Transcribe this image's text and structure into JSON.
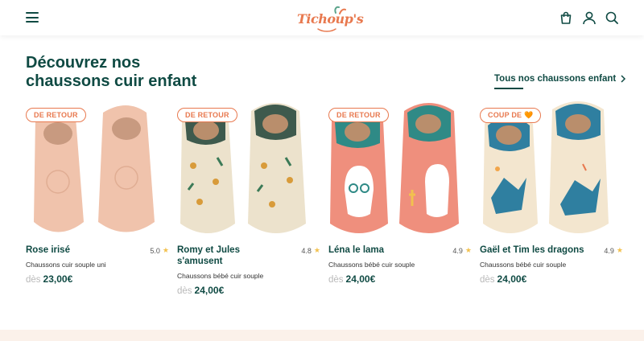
{
  "header": {
    "logo_text": "Tichoup's",
    "icons": [
      "menu-icon",
      "bag-icon",
      "user-icon",
      "search-icon"
    ]
  },
  "section": {
    "title_line1": "Découvrez nos",
    "title_line2": "chaussons cuir enfant",
    "see_all": "Tous nos chaussons enfant"
  },
  "products": [
    {
      "badge": "DE RETOUR",
      "name": "Rose irisé",
      "rating": "5.0",
      "description": "Chaussons cuir souple uni",
      "price_prefix": "dès",
      "price": "23,00€",
      "colors": {
        "main": "#f0c3ac",
        "accent": "#e6ad93"
      }
    },
    {
      "badge": "DE RETOUR",
      "name": "Romy et Jules s'amusent",
      "rating": "4.8",
      "description": "Chaussons bébé cuir souple",
      "price_prefix": "dès",
      "price": "24,00€",
      "colors": {
        "main": "#ece2cc",
        "accent": "#3e5a4d"
      }
    },
    {
      "badge": "DE RETOUR",
      "name": "Léna le lama",
      "rating": "4.9",
      "description": "Chaussons bébé cuir souple",
      "price_prefix": "dès",
      "price": "24,00€",
      "colors": {
        "main": "#ef8f7d",
        "accent": "#2f8a86"
      }
    },
    {
      "badge": "COUP DE 🧡",
      "name": "Gaël et Tim les dragons",
      "rating": "4.9",
      "description": "Chaussons bébé cuir souple",
      "price_prefix": "dès",
      "price": "24,00€",
      "colors": {
        "main": "#f3e6cf",
        "accent": "#2f7fa0"
      }
    }
  ]
}
